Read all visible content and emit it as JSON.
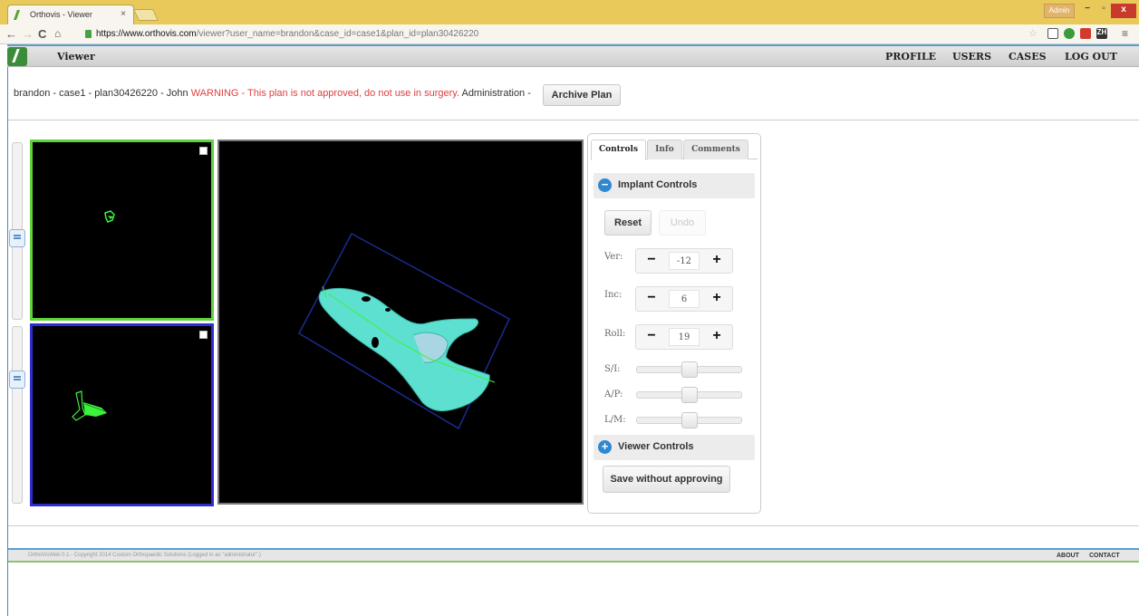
{
  "browser": {
    "tab_title": "Orthovis - Viewer",
    "tab_close": "×",
    "user_badge": "Admin",
    "url_host": "https://www.orthovis.com",
    "url_path": "/viewer?user_name=brandon&case_id=case1&plan_id=plan30426220",
    "min": "−",
    "max": "▫",
    "close": "x"
  },
  "header": {
    "title": "Viewer",
    "nav": [
      "PROFILE",
      "USERS",
      "CASES",
      "LOG OUT"
    ]
  },
  "info": {
    "prefix": "brandon - case1 - plan30426220 - John ",
    "warning": "WARNING - This plan is not approved, do not use in surgery.",
    "suffix": " Administration -",
    "archive_button": "Archive Plan"
  },
  "panel": {
    "tabs": [
      "Controls",
      "Info",
      "Comments"
    ],
    "implant_controls": "Implant Controls",
    "implant_icon": "−",
    "reset": "Reset",
    "undo": "Undo",
    "steppers": [
      {
        "label": "Ver:",
        "value": "-12"
      },
      {
        "label": "Inc:",
        "value": "6"
      },
      {
        "label": "Roll:",
        "value": "19"
      }
    ],
    "minus": "−",
    "plus": "+",
    "sliders": [
      {
        "label": "S/I:",
        "value": 0.5
      },
      {
        "label": "A/P:",
        "value": 0.5
      },
      {
        "label": "L/M:",
        "value": 0.5
      }
    ],
    "viewer_controls": "Viewer Controls",
    "viewer_icon": "+",
    "save_button": "Save without approving"
  },
  "footer": {
    "copyright": "OrthoVisWeb 0.1 - Copyright 2014 Custom Orthopaedic Solutions (Logged in as \"administrator\".)",
    "about": "ABOUT",
    "contact": "CONTACT"
  }
}
